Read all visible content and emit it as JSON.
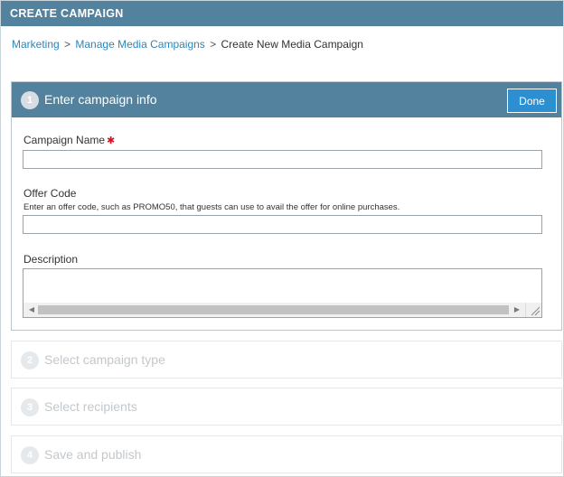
{
  "header": {
    "title": "CREATE CAMPAIGN"
  },
  "breadcrumb": {
    "items": [
      "Marketing",
      "Manage Media Campaigns"
    ],
    "separator": ">",
    "current": "Create New Media Campaign"
  },
  "steps": [
    {
      "number": "1",
      "title": "Enter campaign info",
      "done_label": "Done",
      "fields": {
        "campaign_name": {
          "label": "Campaign Name",
          "required_mark": "✱",
          "value": ""
        },
        "offer_code": {
          "label": "Offer Code",
          "help": "Enter an offer code, such as PROMO50, that guests can use to avail the offer for online purchases.",
          "value": ""
        },
        "description": {
          "label": "Description",
          "value": ""
        }
      }
    },
    {
      "number": "2",
      "title": "Select campaign type"
    },
    {
      "number": "3",
      "title": "Select recipients"
    },
    {
      "number": "4",
      "title": "Save and publish"
    }
  ],
  "colors": {
    "header_bg": "#52829e",
    "link": "#2e85b8",
    "done_button": "#2c8fd1",
    "required": "#d4122a",
    "disabled_text": "#c3c8cc"
  }
}
